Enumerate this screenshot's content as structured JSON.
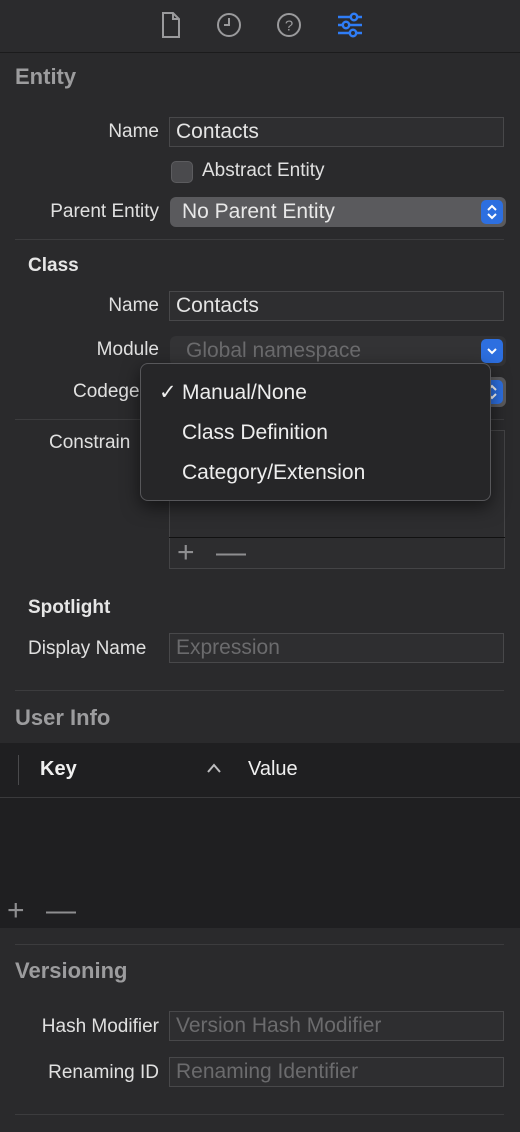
{
  "toolbar": {
    "icons": [
      "file-icon",
      "clock-icon",
      "help-icon",
      "sliders-icon"
    ],
    "active_color": "#2f7df6"
  },
  "entity": {
    "title": "Entity",
    "name_label": "Name",
    "name_value": "Contacts",
    "abstract_label": "Abstract Entity",
    "abstract_checked": false,
    "parent_label": "Parent Entity",
    "parent_value": "No Parent Entity"
  },
  "class": {
    "title": "Class",
    "name_label": "Name",
    "name_value": "Contacts",
    "module_label": "Module",
    "module_value": "Global namespace",
    "codegen_label": "Codege",
    "constraints_label": "Constrain"
  },
  "codegen_menu": {
    "items": [
      {
        "label": "Manual/None",
        "checked": true,
        "check": "✓"
      },
      {
        "label": "Class Definition",
        "checked": false,
        "check": ""
      },
      {
        "label": "Category/Extension",
        "checked": false,
        "check": ""
      }
    ]
  },
  "spotlight": {
    "title": "Spotlight",
    "display_name_label": "Display Name",
    "display_name_placeholder": "Expression"
  },
  "user_info": {
    "title": "User Info",
    "columns": [
      "Key",
      "Value"
    ],
    "rows": []
  },
  "versioning": {
    "title": "Versioning",
    "hash_label": "Hash Modifier",
    "hash_placeholder": "Version Hash Modifier",
    "renaming_label": "Renaming ID",
    "renaming_placeholder": "Renaming Identifier"
  },
  "controls": {
    "plus": "+",
    "minus": "—"
  }
}
